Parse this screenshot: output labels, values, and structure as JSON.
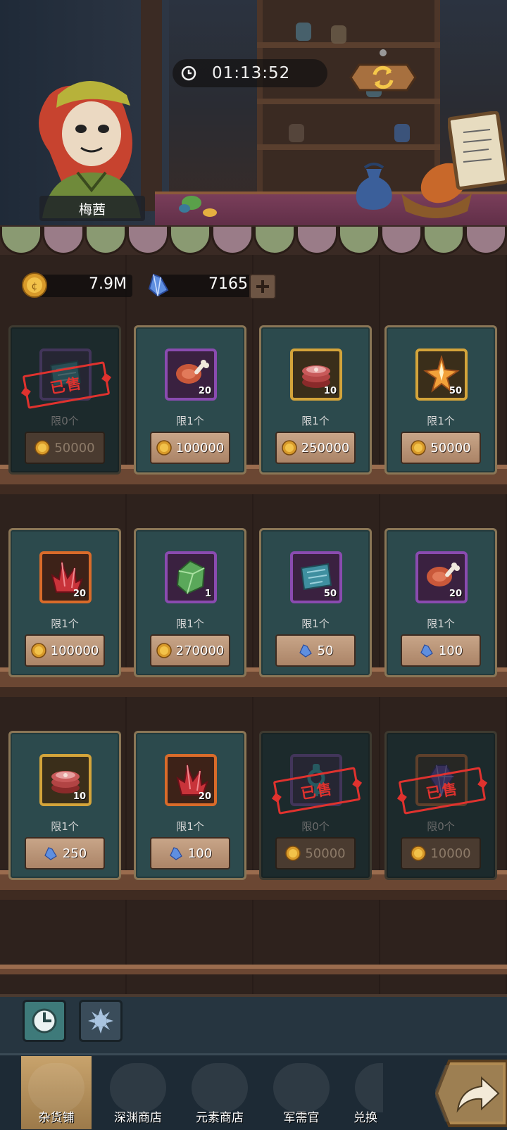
{
  "header": {
    "timer": "01:13:52",
    "merchant_name": "梅茜"
  },
  "currency": {
    "gold": "7.9M",
    "gems": "7165"
  },
  "shop": {
    "rows": [
      [
        {
          "icon": "scroll-icon",
          "qty": "",
          "limit": "限0个",
          "price": "50000",
          "currency": "gold",
          "sold": true,
          "stamp": "已售",
          "rarity": "purple"
        },
        {
          "icon": "meat-icon",
          "qty": "20",
          "limit": "限1个",
          "price": "100000",
          "currency": "gold",
          "sold": false,
          "rarity": "purple"
        },
        {
          "icon": "ham-stack-icon",
          "qty": "10",
          "limit": "限1个",
          "price": "250000",
          "currency": "gold",
          "sold": false,
          "rarity": "gold"
        },
        {
          "icon": "star-crystal-icon",
          "qty": "50",
          "limit": "限1个",
          "price": "50000",
          "currency": "gold",
          "sold": false,
          "rarity": "gold"
        }
      ],
      [
        {
          "icon": "red-crystal-icon",
          "qty": "20",
          "limit": "限1个",
          "price": "100000",
          "currency": "gold",
          "sold": false,
          "rarity": "orange"
        },
        {
          "icon": "green-gem-icon",
          "qty": "1",
          "limit": "限1个",
          "price": "270000",
          "currency": "gold",
          "sold": false,
          "rarity": "purple"
        },
        {
          "icon": "scroll-icon",
          "qty": "50",
          "limit": "限1个",
          "price": "50",
          "currency": "gem",
          "sold": false,
          "rarity": "purple"
        },
        {
          "icon": "meat-icon",
          "qty": "20",
          "limit": "限1个",
          "price": "100",
          "currency": "gem",
          "sold": false,
          "rarity": "purple"
        }
      ],
      [
        {
          "icon": "ham-stack-icon",
          "qty": "10",
          "limit": "限1个",
          "price": "250",
          "currency": "gem",
          "sold": false,
          "rarity": "gold"
        },
        {
          "icon": "red-crystal-icon",
          "qty": "20",
          "limit": "限1个",
          "price": "100",
          "currency": "gem",
          "sold": false,
          "rarity": "orange"
        },
        {
          "icon": "key-icon",
          "qty": "",
          "limit": "限0个",
          "price": "50000",
          "currency": "gold",
          "sold": true,
          "stamp": "已售",
          "rarity": "purple"
        },
        {
          "icon": "purple-gem-icon",
          "qty": "",
          "limit": "限0个",
          "price": "10000",
          "currency": "gold",
          "sold": true,
          "stamp": "已售",
          "rarity": "orange"
        }
      ]
    ]
  },
  "nav": {
    "tabs": [
      {
        "label": "杂货铺",
        "icon": "coins-icon",
        "active": true
      },
      {
        "label": "深渊商店",
        "icon": "abyss-icon",
        "active": false
      },
      {
        "label": "元素商店",
        "icon": "element-icon",
        "active": false
      },
      {
        "label": "军需官",
        "icon": "quartermaster-icon",
        "active": false
      },
      {
        "label": "兑换",
        "icon": "exchange-icon",
        "active": false
      }
    ]
  },
  "colors": {
    "card_bg": "#2c4a4d",
    "card_border": "#8a7656",
    "sold_stamp": "#e0322e",
    "price_button": "#c8a588",
    "active_tab": "#c8a36c"
  }
}
